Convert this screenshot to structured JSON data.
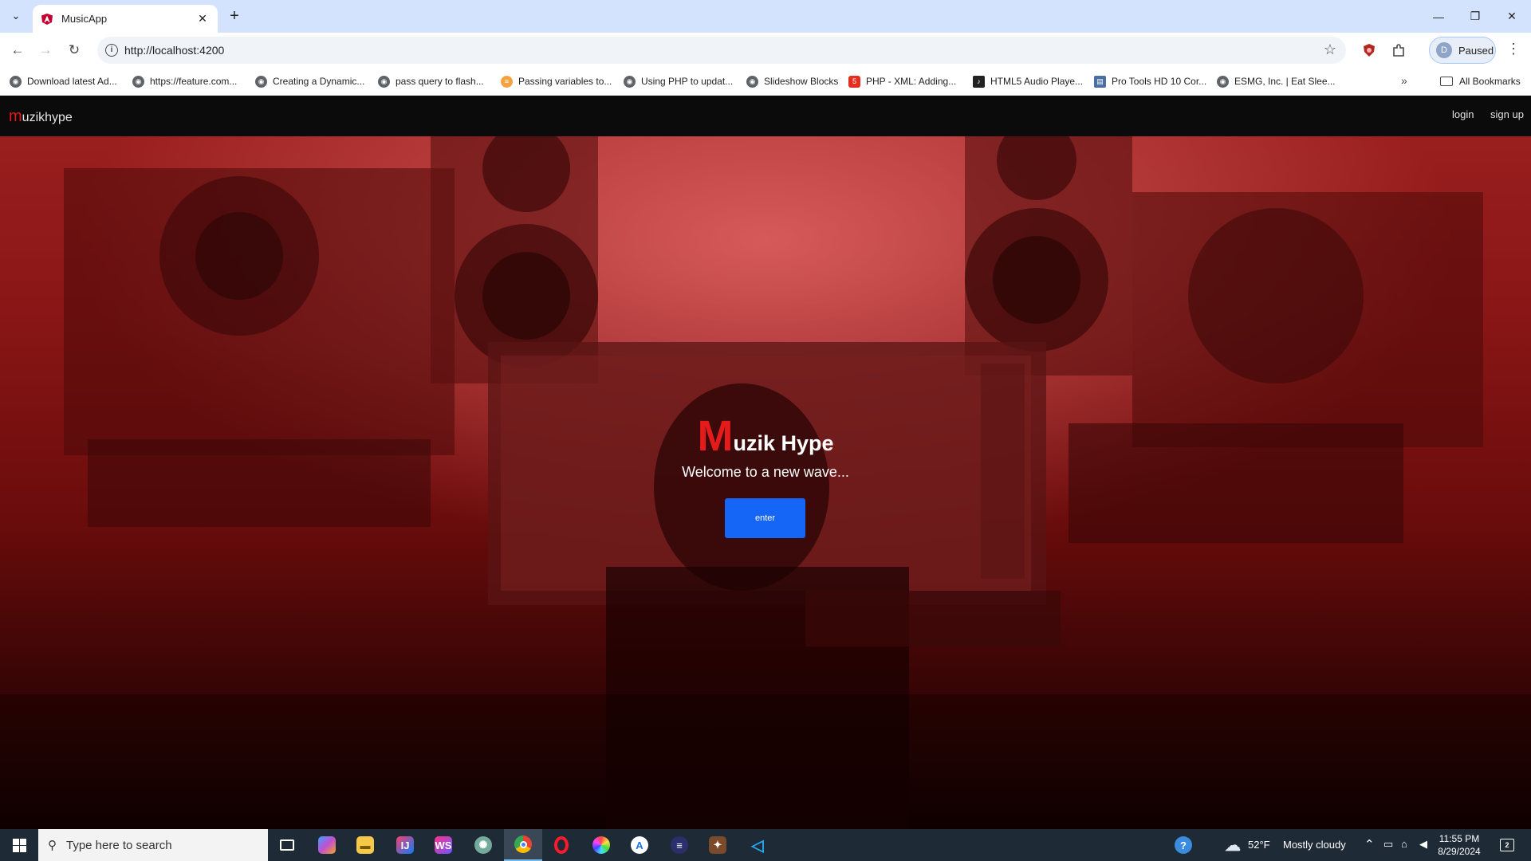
{
  "browser": {
    "tab_title": "MusicApp",
    "url": "http://localhost:4200",
    "profile_initial": "D",
    "profile_label": "Paused",
    "bookmarks": [
      "Download latest Ad...",
      "https://feature.com...",
      "Creating a Dynamic...",
      "pass query to flash...",
      "Passing variables to...",
      "Using PHP to updat...",
      "Slideshow Blocks",
      "PHP - XML: Adding...",
      "HTML5 Audio Playe...",
      "Pro Tools HD 10 Cor...",
      "ESMG, Inc. | Eat Slee..."
    ],
    "all_bookmarks": "All Bookmarks"
  },
  "app": {
    "brand_m": "m",
    "brand_rest": "uzikhype",
    "login": "login",
    "signup": "sign up"
  },
  "hero": {
    "title_m": "M",
    "title_rest": "uzik Hype",
    "subtitle": "Welcome to a new wave...",
    "enter_label": "enter"
  },
  "taskbar": {
    "search_placeholder": "Type here to search",
    "weather_temp": "52°F",
    "weather_desc": "Mostly cloudy",
    "time": "11:55 PM",
    "date": "8/29/2024",
    "notification_count": "2"
  },
  "colors": {
    "accent_red": "#e51a1a",
    "button_blue": "#1565f7",
    "nav_bg": "#0b0b0b"
  }
}
